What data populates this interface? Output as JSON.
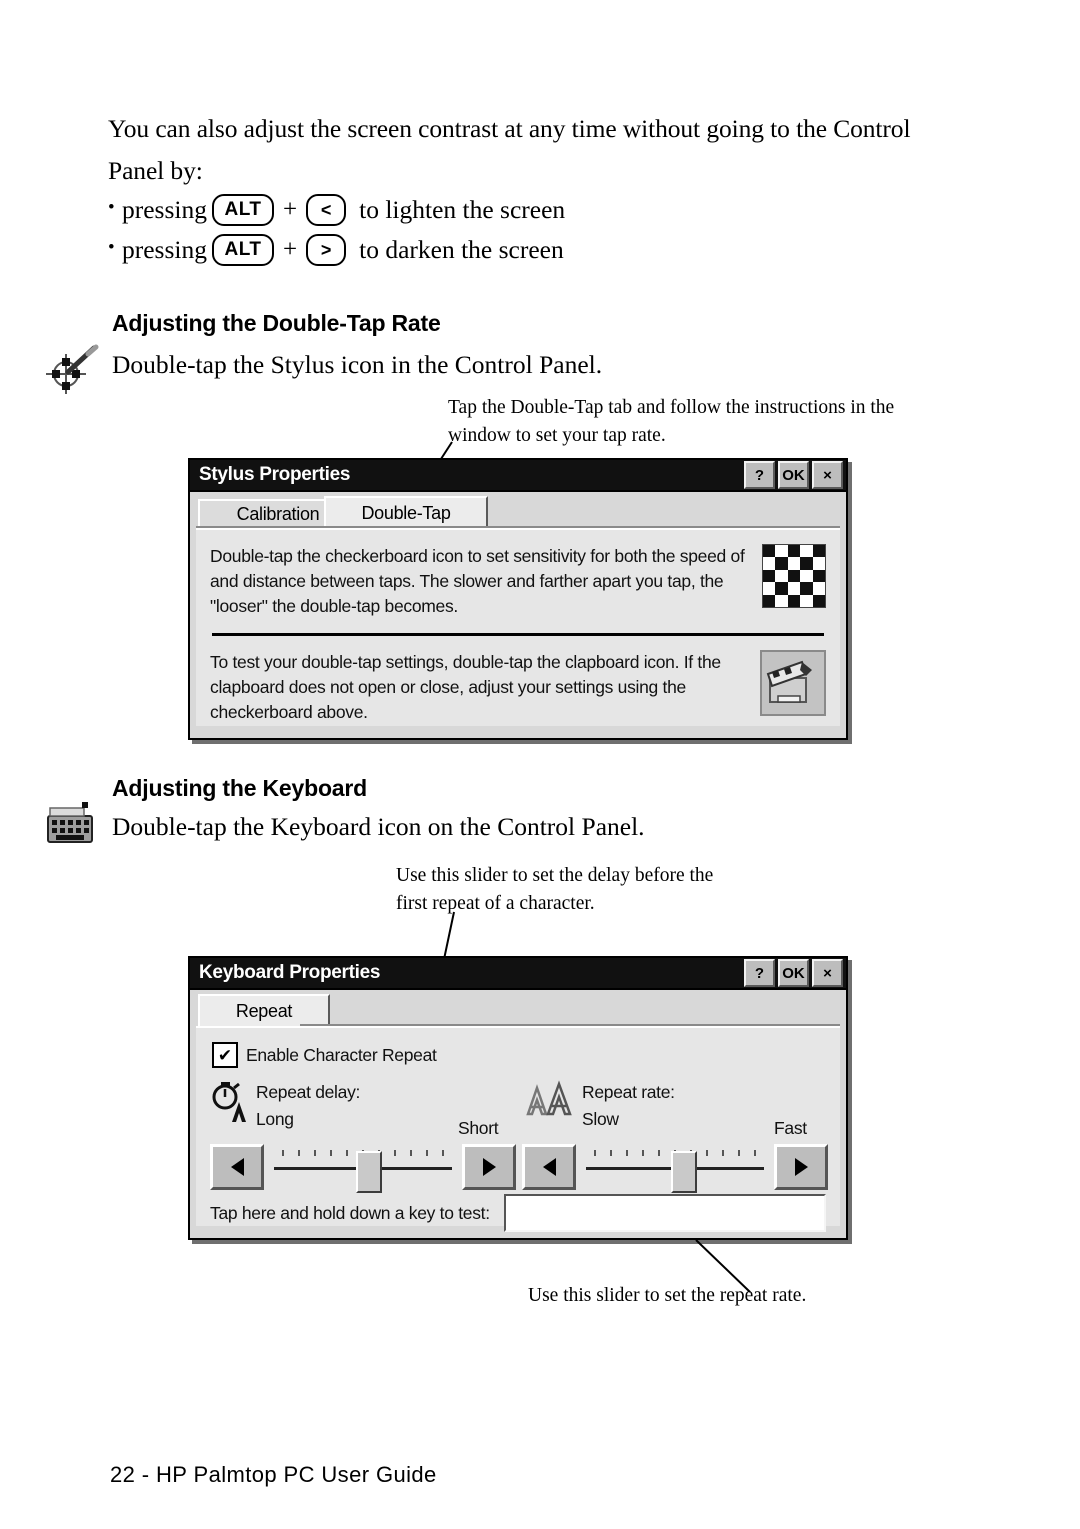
{
  "body": {
    "intro": "You can also adjust the screen contrast at any time without going to the Control Panel by:",
    "bullets": [
      {
        "lead": "pressing",
        "key1": "ALT",
        "plus": "+",
        "key2": "<",
        "tail": "to lighten the screen"
      },
      {
        "lead": "pressing",
        "key1": "ALT",
        "plus": "+",
        "key2": ">",
        "tail": "to darken the screen"
      }
    ]
  },
  "sections": [
    {
      "heading": "Adjusting the Double-Tap Rate",
      "instruction": "Double-tap the Stylus icon in the Control Panel.",
      "icon": "stylus-crosshair-icon",
      "callout": "Tap the Double-Tap tab and follow the instructions in the window to set your tap rate."
    },
    {
      "heading": "Adjusting the Keyboard",
      "instruction": "Double-tap the Keyboard icon on the Control Panel.",
      "icon": "keyboard-icon",
      "callout_top": "Use this slider to set the delay before the first repeat of a character.",
      "callout_bottom": "Use this slider to set the repeat rate."
    }
  ],
  "stylus_dialog": {
    "title": "Stylus Properties",
    "buttons": {
      "help": "?",
      "ok": "OK",
      "close": "×"
    },
    "tabs": [
      {
        "label": "Calibration",
        "active": false
      },
      {
        "label": "Double-Tap",
        "active": true
      }
    ],
    "top_text": "Double-tap the checkerboard icon to set sensitivity for both the speed of and distance between taps. The slower and farther apart you tap, the \"looser\" the double-tap becomes.",
    "top_icon": "checkerboard-icon",
    "bottom_text": "To test your double-tap settings, double-tap the clapboard icon. If the clapboard does not open or close, adjust your settings using the checkerboard above.",
    "bottom_icon": "clapboard-icon"
  },
  "keyboard_dialog": {
    "title": "Keyboard Properties",
    "buttons": {
      "help": "?",
      "ok": "OK",
      "close": "×"
    },
    "tabs": [
      {
        "label": "Repeat",
        "active": true
      }
    ],
    "enable_checkbox": {
      "label": "Enable Character Repeat",
      "checked": true,
      "mark": "✔"
    },
    "repeat_delay": {
      "icon": "stopwatch-a-icon",
      "label": "Repeat delay:",
      "min_label": "Long",
      "max_label": "Short",
      "value_percent": 52
    },
    "repeat_rate": {
      "icon": "double-a-icon",
      "label": "Repeat rate:",
      "min_label": "Slow",
      "max_label": "Fast",
      "value_percent": 54
    },
    "test_label": "Tap here and hold down a key to test:",
    "test_value": ""
  },
  "footer": "22 - HP Palmtop PC User Guide",
  "colors": {
    "titlebar_bg": "#111111",
    "dialog_face": "#d8d8d8",
    "panel_face": "#e6e6e6",
    "button_face": "#bdbdbd"
  }
}
